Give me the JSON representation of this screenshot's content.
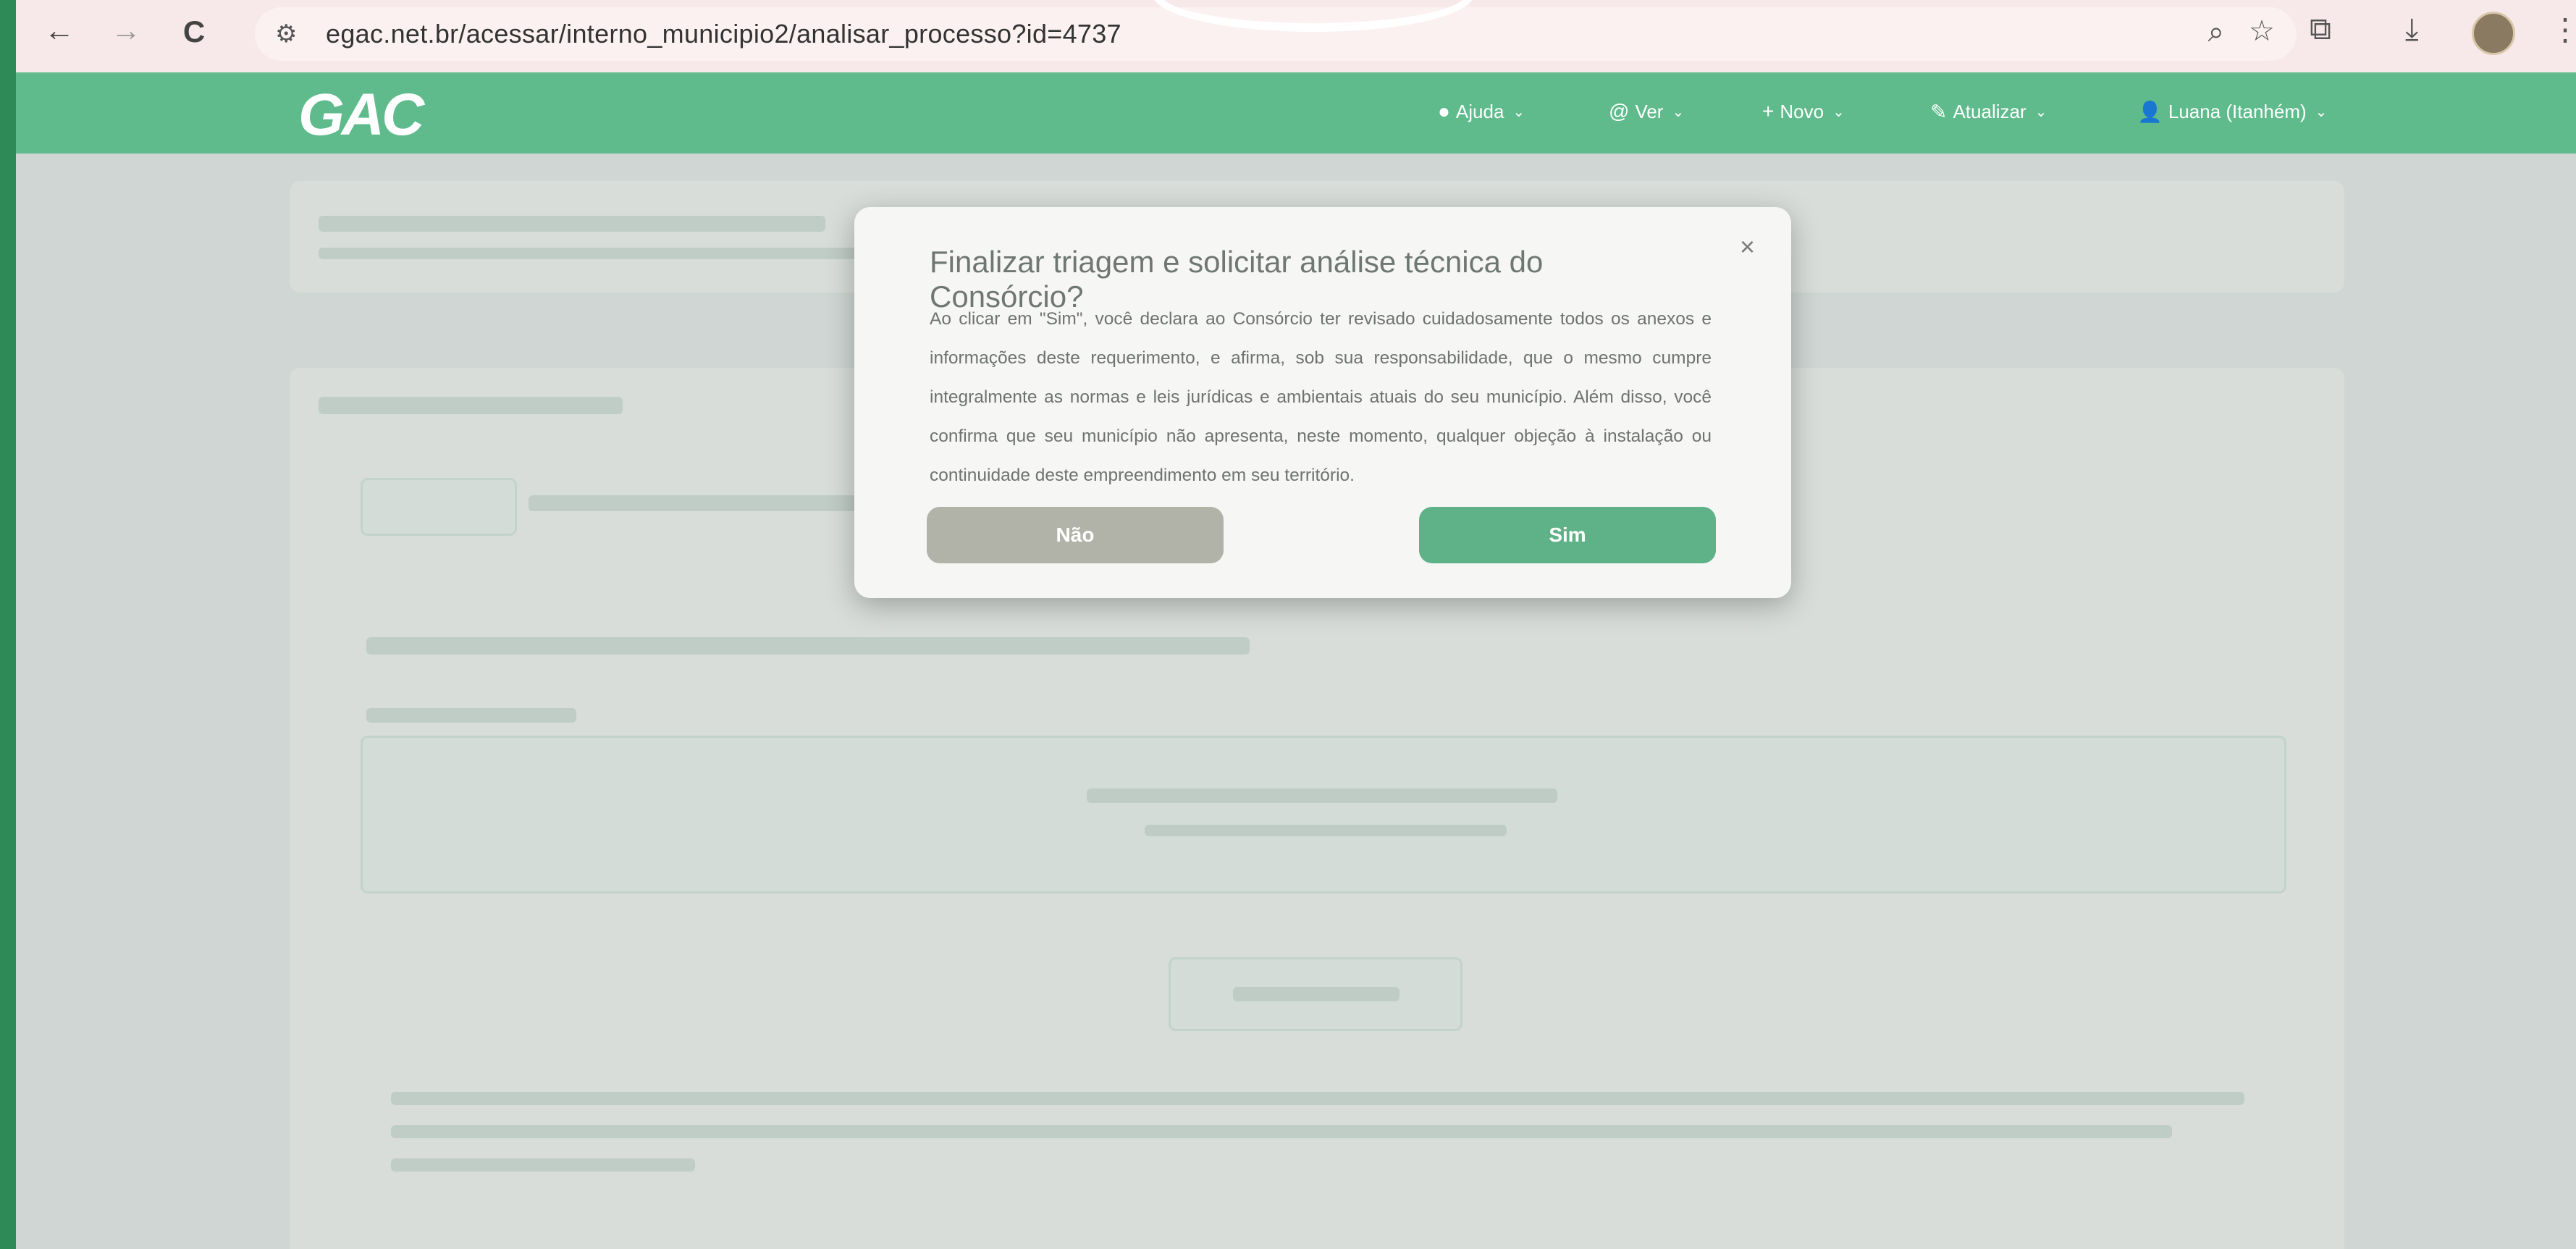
{
  "browser": {
    "back": "←",
    "forward": "→",
    "reload": "C",
    "url": "egac.net.br/acessar/interno_municipio2/analisar_processo?id=4737"
  },
  "header": {
    "logo": "GAC",
    "menu": [
      {
        "icon": "●",
        "label": "Ajuda"
      },
      {
        "icon": "@",
        "label": "Ver"
      },
      {
        "icon": "+",
        "label": "Novo"
      },
      {
        "icon": "✎",
        "label": "Atualizar"
      },
      {
        "icon": "👤",
        "label": "Luana (Itanhém)"
      }
    ]
  },
  "modal": {
    "title": "Finalizar triagem e solicitar análise técnica do Consórcio?",
    "close": "×",
    "body": "Ao clicar em \"Sim\", você declara ao Consórcio ter revisado cuidadosamente todos os anexos e informações deste requerimento, e afirma, sob sua responsabilidade, que o mesmo cumpre integralmente as normas e leis jurídicas e ambientais atuais do seu município. Além disso, você confirma que seu município não apresenta, neste momento, qualquer objeção à instalação ou continuidade deste empreendimento em seu território.",
    "no": "Não",
    "yes": "Sim"
  }
}
